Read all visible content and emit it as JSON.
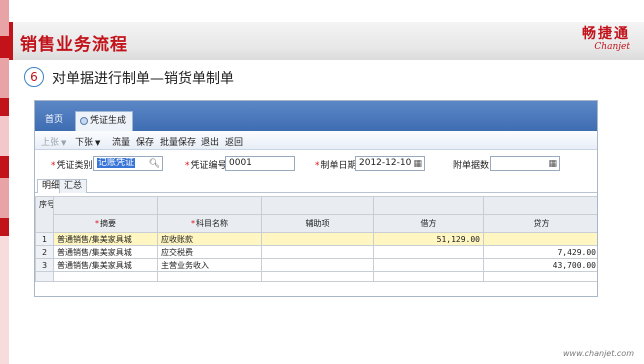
{
  "slide": {
    "title": "销售业务流程",
    "logo_cn": "畅捷通",
    "logo_en": "Chanjet",
    "step_number": "6",
    "step_text": "对单据进行制单—销货单制单",
    "footer_url": "www.chanjet.com",
    "colors": {
      "brand": "#c2131b",
      "stripe_dark": "#c2131b",
      "stripe_light": "#e8a3a6"
    }
  },
  "app": {
    "tabs": [
      {
        "label": "首页"
      },
      {
        "label": "凭证生成",
        "icon": "document-icon",
        "active": true
      }
    ],
    "toolbar": [
      {
        "label": "上张",
        "has_arrow": true,
        "disabled": true
      },
      {
        "label": "下张",
        "has_arrow": true,
        "disabled": false
      },
      {
        "label": "流量"
      },
      {
        "label": "保存"
      },
      {
        "label": "批量保存"
      },
      {
        "label": "退出"
      },
      {
        "label": "返回"
      }
    ],
    "form": {
      "voucher_type_label": "凭证类别",
      "voucher_type_value": "记账凭证",
      "voucher_no_label": "凭证编号",
      "voucher_no_value": "0001",
      "date_label": "制单日期",
      "date_value": "2012-12-10",
      "attachments_label": "附单据数",
      "attachments_value": ""
    },
    "subtabs": [
      "明细",
      "汇总"
    ],
    "grid": {
      "corner": "序号",
      "columns": [
        "摘要",
        "科目名称",
        "辅助项",
        "借方",
        "贷方"
      ],
      "required_columns": [
        true,
        true,
        false,
        false,
        false
      ],
      "rows": [
        {
          "seq": "1",
          "summary": "普通销售/集美家具城",
          "account": "应收账款",
          "aux": "",
          "debit": "51,129.00",
          "credit": "",
          "highlight": true
        },
        {
          "seq": "2",
          "summary": "普通销售/集美家具城",
          "account": "应交税费",
          "aux": "",
          "debit": "",
          "credit": "7,429.00",
          "highlight": false
        },
        {
          "seq": "3",
          "summary": "普通销售/集美家具城",
          "account": "主营业务收入",
          "aux": "",
          "debit": "",
          "credit": "43,700.00",
          "highlight": false
        }
      ]
    }
  }
}
